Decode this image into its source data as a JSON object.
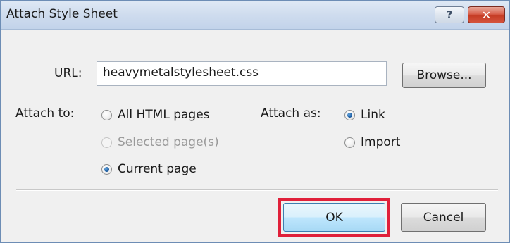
{
  "window": {
    "title": "Attach Style Sheet",
    "help_label": "?",
    "close_label": "✕"
  },
  "url": {
    "label": "URL:",
    "value": "heavymetalstylesheet.css"
  },
  "browse_label": "Browse...",
  "attach_to": {
    "label": "Attach to:",
    "options": [
      {
        "label": "All HTML pages",
        "checked": false,
        "disabled": false
      },
      {
        "label": "Selected page(s)",
        "checked": false,
        "disabled": true
      },
      {
        "label": "Current page",
        "checked": true,
        "disabled": false
      }
    ]
  },
  "attach_as": {
    "label": "Attach as:",
    "options": [
      {
        "label": "Link",
        "checked": true,
        "disabled": false
      },
      {
        "label": "Import",
        "checked": false,
        "disabled": false
      }
    ]
  },
  "buttons": {
    "ok_label": "OK",
    "cancel_label": "Cancel"
  },
  "colors": {
    "highlight": "#e0203a",
    "radio_checked": "#1d5fa5",
    "title_bar": "#cfdcee"
  }
}
